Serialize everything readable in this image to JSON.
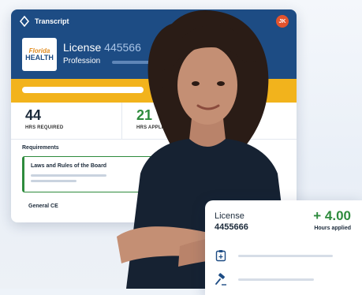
{
  "window": {
    "dots": "• • •",
    "title": "Transcript",
    "user_initials": "JK"
  },
  "brand": {
    "logo_top": "Florida",
    "logo_bottom": "HEALTH"
  },
  "license": {
    "label": "License",
    "number": "445566",
    "profession_label": "Profession"
  },
  "stats": [
    {
      "value": "44",
      "label": "HRS REQUIRED"
    },
    {
      "value": "21",
      "label": "HRS APPLIED"
    }
  ],
  "requirements": {
    "title": "Requirements",
    "items": [
      "Laws and Rules of the Board"
    ],
    "general_label": "General CE"
  },
  "floating_card": {
    "label": "License",
    "number": "4455666",
    "hours_value": "+ 4.00",
    "hours_label": "Hours applied"
  },
  "colors": {
    "navy": "#1d4c84",
    "gold": "#f2b31c",
    "green": "#2e8b3d"
  }
}
